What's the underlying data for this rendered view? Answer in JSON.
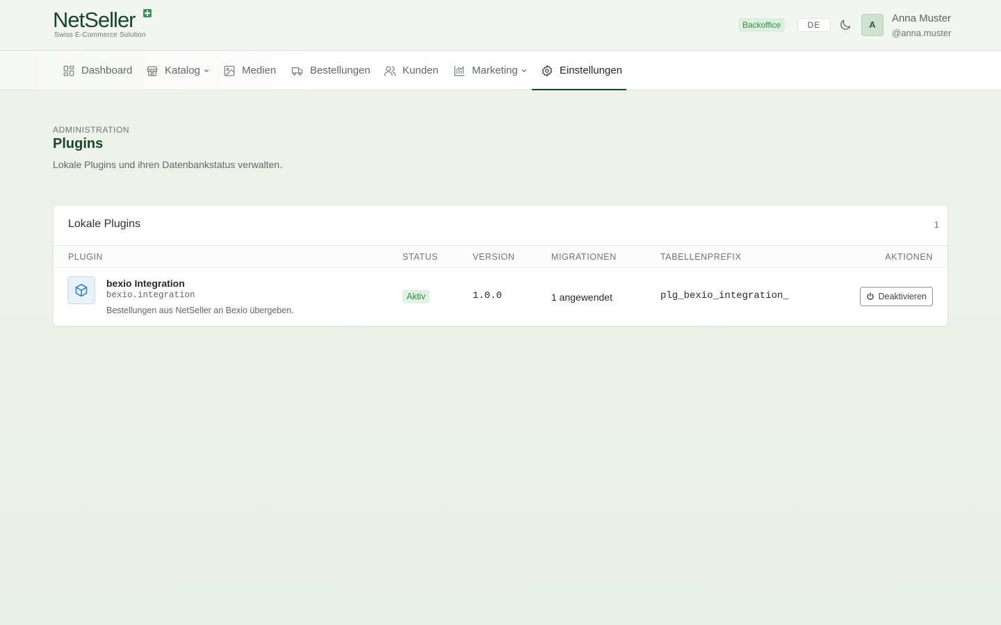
{
  "brand": {
    "name_part1": "Net",
    "name_part2": "Seller",
    "tagline": "Swiss E-Commerce Solution",
    "color": "#1a4430",
    "accent": "#2e9a55"
  },
  "header": {
    "env_badge": "Backoffice",
    "language": "DE",
    "theme_icon": "moon-icon",
    "user": {
      "initial": "A",
      "name": "Anna Muster",
      "handle": "@anna.muster"
    }
  },
  "nav": {
    "items": [
      {
        "label": "Dashboard",
        "icon": "dashboard-icon",
        "has_dropdown": false,
        "active": false
      },
      {
        "label": "Katalog",
        "icon": "store-icon",
        "has_dropdown": true,
        "active": false
      },
      {
        "label": "Medien",
        "icon": "image-icon",
        "has_dropdown": false,
        "active": false
      },
      {
        "label": "Bestellungen",
        "icon": "truck-icon",
        "has_dropdown": false,
        "active": false
      },
      {
        "label": "Kunden",
        "icon": "users-icon",
        "has_dropdown": false,
        "active": false
      },
      {
        "label": "Marketing",
        "icon": "chart-icon",
        "has_dropdown": true,
        "active": false
      },
      {
        "label": "Einstellungen",
        "icon": "gear-icon",
        "has_dropdown": false,
        "active": true
      }
    ]
  },
  "page": {
    "eyebrow": "ADMINISTRATION",
    "title": "Plugins",
    "subtitle": "Lokale Plugins und ihren Datenbankstatus verwalten."
  },
  "card": {
    "title": "Lokale Plugins",
    "count": "1",
    "columns": [
      "PLUGIN",
      "STATUS",
      "VERSION",
      "MIGRATIONEN",
      "TABELLENPREFIX",
      "AKTIONEN"
    ],
    "rows": [
      {
        "icon": "package-icon",
        "name": "bexio Integration",
        "id": "bexio.integration",
        "description": "Bestellungen aus NetSeller an Bexio übergeben.",
        "status": "Aktiv",
        "version": "1.0.0",
        "migrations": "1 angewendet",
        "prefix": "plg_bexio_integration_",
        "action_label": "Deaktivieren",
        "action_icon": "power-icon"
      }
    ]
  }
}
